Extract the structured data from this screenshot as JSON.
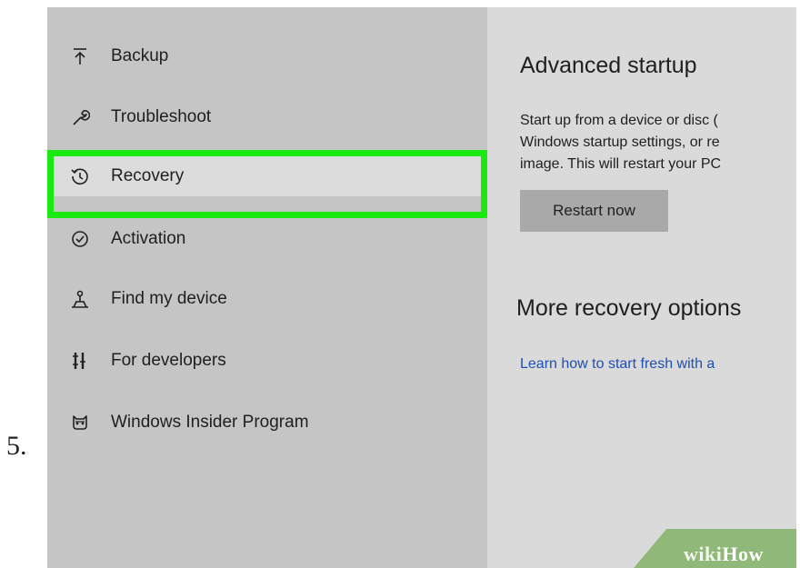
{
  "step_number": "5.",
  "sidebar": {
    "items": [
      {
        "label": "Backup",
        "icon": "backup-icon"
      },
      {
        "label": "Troubleshoot",
        "icon": "wrench-icon"
      },
      {
        "label": "Recovery",
        "icon": "recovery-icon",
        "selected": true
      },
      {
        "label": "Activation",
        "icon": "check-circle-icon"
      },
      {
        "label": "Find my device",
        "icon": "find-device-icon"
      },
      {
        "label": "For developers",
        "icon": "developers-icon"
      },
      {
        "label": "Windows Insider Program",
        "icon": "insider-icon"
      }
    ]
  },
  "main": {
    "advanced_startup_title": "Advanced startup",
    "description_lines": [
      "Start up from a device or disc (",
      "Windows startup settings, or re",
      "image. This will restart your PC"
    ],
    "restart_button": "Restart now",
    "more_options_title": "More recovery options",
    "learn_link": "Learn how to start fresh with a"
  },
  "watermark": {
    "part1": "wiki",
    "part2": "How"
  },
  "colors": {
    "highlight": "#1aea12",
    "link": "#1f4fb0",
    "sidebar_bg": "#c5c5c5",
    "main_bg": "#dadada"
  }
}
